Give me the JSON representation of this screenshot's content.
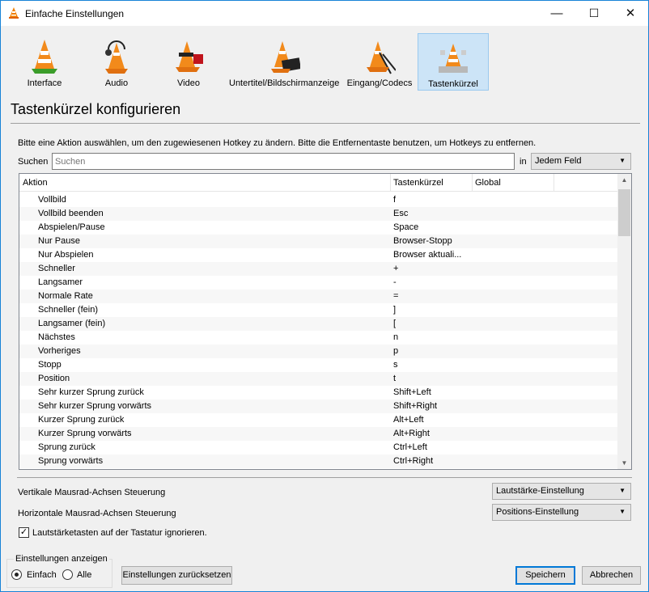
{
  "window": {
    "title": "Einfache Einstellungen",
    "min": "—",
    "max": "☐",
    "close": "✕"
  },
  "categories": [
    {
      "label": "Interface",
      "icon": "interface-cone-icon"
    },
    {
      "label": "Audio",
      "icon": "audio-cone-icon"
    },
    {
      "label": "Video",
      "icon": "video-cone-icon"
    },
    {
      "label": "Untertitel/Bildschirmanzeige",
      "icon": "subtitles-cone-icon"
    },
    {
      "label": "Eingang/Codecs",
      "icon": "input-codecs-cone-icon"
    },
    {
      "label": "Tastenkürzel",
      "icon": "hotkeys-cone-icon",
      "selected": true
    }
  ],
  "page_title": "Tastenkürzel konfigurieren",
  "instructions": "Bitte eine Aktion auswählen, um den zugewiesenen Hotkey zu ändern. Bitte die Entfernentaste benutzen, um Hotkeys zu entfernen.",
  "search": {
    "label": "Suchen",
    "placeholder": "Suchen",
    "in_label": "in",
    "field": "Jedem Feld"
  },
  "table": {
    "headers": [
      "Aktion",
      "Tastenkürzel",
      "Global"
    ],
    "rows": [
      [
        "Vollbild",
        "f"
      ],
      [
        "Vollbild beenden",
        "Esc"
      ],
      [
        "Abspielen/Pause",
        "Space"
      ],
      [
        "Nur Pause",
        "Browser-Stopp"
      ],
      [
        "Nur Abspielen",
        "Browser aktuali..."
      ],
      [
        "Schneller",
        "+"
      ],
      [
        "Langsamer",
        "-"
      ],
      [
        "Normale Rate",
        "="
      ],
      [
        "Schneller (fein)",
        "]"
      ],
      [
        "Langsamer (fein)",
        "["
      ],
      [
        "Nächstes",
        "n"
      ],
      [
        "Vorheriges",
        "p"
      ],
      [
        "Stopp",
        "s"
      ],
      [
        "Position",
        "t"
      ],
      [
        "Sehr kurzer Sprung zurück",
        "Shift+Left"
      ],
      [
        "Sehr kurzer Sprung vorwärts",
        "Shift+Right"
      ],
      [
        "Kurzer Sprung zurück",
        "Alt+Left"
      ],
      [
        "Kurzer Sprung vorwärts",
        "Alt+Right"
      ],
      [
        "Sprung zurück",
        "Ctrl+Left"
      ],
      [
        "Sprung vorwärts",
        "Ctrl+Right"
      ]
    ]
  },
  "mouse": {
    "vertical_label": "Vertikale Mausrad-Achsen Steuerung",
    "vertical_value": "Lautstärke-Einstellung",
    "horizontal_label": "Horizontale Mausrad-Achsen Steuerung",
    "horizontal_value": "Positions-Einstellung"
  },
  "ignore_volume_keys": {
    "label": "Lautstärketasten auf der Tastatur ignorieren.",
    "checked": true
  },
  "show_settings": {
    "label": "Einstellungen anzeigen",
    "simple": "Einfach",
    "all": "Alle",
    "selected": "Einfach"
  },
  "buttons": {
    "reset": "Einstellungen zurücksetzen",
    "save": "Speichern",
    "cancel": "Abbrechen"
  }
}
